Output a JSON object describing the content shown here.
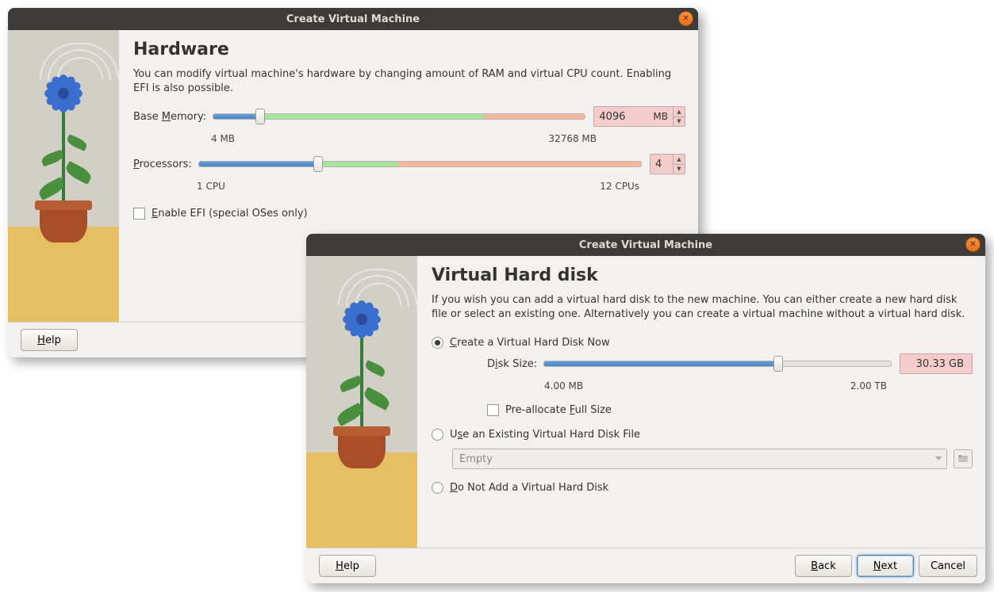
{
  "dlg1": {
    "title": "Create Virtual Machine",
    "heading": "Hardware",
    "description": "You can modify virtual machine's hardware by changing amount of RAM and virtual CPU count. Enabling EFI is also possible.",
    "memory": {
      "label_pre": "Base ",
      "label_u": "M",
      "label_post": "emory:",
      "value": "4096",
      "unit": "MB",
      "min_label": "4 MB",
      "max_label": "32768 MB"
    },
    "cpu": {
      "label_u": "P",
      "label_post": "rocessors:",
      "value": "4",
      "min_label": "1 CPU",
      "max_label": "12 CPUs"
    },
    "efi": {
      "label_u": "E",
      "label_post": "nable EFI (special OSes only)",
      "checked": false
    },
    "buttons": {
      "help_u": "H",
      "help_post": "elp"
    }
  },
  "dlg2": {
    "title": "Create Virtual Machine",
    "heading": "Virtual Hard disk",
    "description": "If you wish you can add a virtual hard disk to the new machine. You can either create a new hard disk file or select an existing one. Alternatively you can create a virtual machine without a virtual hard disk.",
    "opt_create": {
      "u": "C",
      "post": "reate a Virtual Hard Disk Now",
      "selected": true
    },
    "disksize": {
      "label_pre": "D",
      "label_u": "i",
      "label_post": "sk Size:",
      "value": "30.33 GB",
      "min_label": "4.00 MB",
      "max_label": "2.00 TB"
    },
    "prealloc": {
      "pre": "Pre-allocate ",
      "u": "F",
      "post": "ull Size",
      "checked": false
    },
    "opt_existing": {
      "pre": "U",
      "u": "s",
      "post": "e an Existing Virtual Hard Disk File",
      "selected": false
    },
    "combo_value": "Empty",
    "opt_none": {
      "u": "D",
      "post": "o Not Add a Virtual Hard Disk",
      "selected": false
    },
    "buttons": {
      "help_u": "H",
      "help_post": "elp",
      "back_u": "B",
      "back_post": "ack",
      "next_u": "N",
      "next_post": "ext",
      "cancel": "Cancel"
    }
  }
}
